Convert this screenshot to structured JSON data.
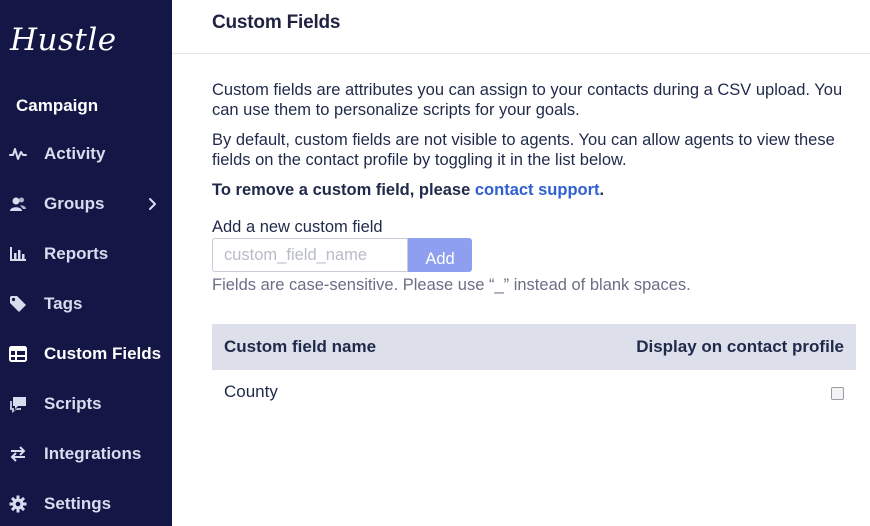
{
  "sidebar": {
    "logo": "Hustle",
    "section": "Campaign",
    "items": [
      {
        "label": "Activity",
        "icon": "activity-icon"
      },
      {
        "label": "Groups",
        "icon": "groups-icon"
      },
      {
        "label": "Reports",
        "icon": "reports-icon"
      },
      {
        "label": "Tags",
        "icon": "tag-icon"
      },
      {
        "label": "Custom Fields",
        "icon": "custom-fields-icon",
        "active": true
      },
      {
        "label": "Scripts",
        "icon": "scripts-icon"
      },
      {
        "label": "Integrations",
        "icon": "integrations-icon"
      },
      {
        "label": "Settings",
        "icon": "gear-icon"
      }
    ]
  },
  "page": {
    "title": "Custom Fields",
    "intro1": "Custom fields are attributes you can assign to your contacts during a CSV upload. You can use them to personalize scripts for your goals.",
    "intro2": "By default, custom fields are not visible to agents. You can allow agents to view these fields on the contact profile by toggling it in the list below.",
    "remove_text": "To remove a custom field, please ",
    "remove_link": "contact support",
    "remove_end": "."
  },
  "form": {
    "label": "Add a new custom field",
    "placeholder": "custom_field_name",
    "value": "",
    "add_label": "Add",
    "hint": "Fields are case-sensitive. Please use “_” instead of blank spaces."
  },
  "table": {
    "headers": [
      "Custom field name",
      "Display on contact profile"
    ],
    "rows": [
      {
        "name": "County",
        "display": false
      }
    ]
  },
  "colors": {
    "sidebar_bg": "#141646",
    "accent_link": "#2f5fd0",
    "button_bg": "#8e9ff0",
    "table_header_bg": "#dde0ea"
  }
}
